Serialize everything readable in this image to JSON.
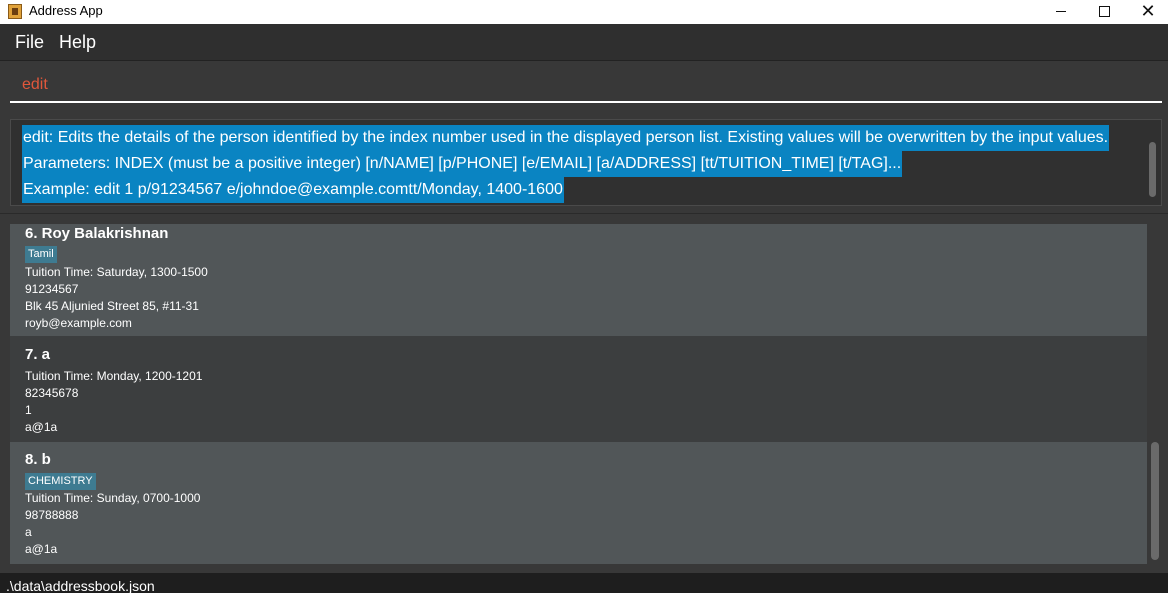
{
  "window": {
    "title": "Address App",
    "icon": "address-book-icon",
    "controls": {
      "minimize": "minimize-icon",
      "maximize": "maximize-icon",
      "close_glyph": "✕"
    }
  },
  "menu": {
    "file": "File",
    "help": "Help"
  },
  "command": {
    "value": "edit"
  },
  "result": {
    "lines": [
      "edit: Edits the details of the person identified by the index number used in the displayed person list. Existing values will be overwritten by the input values.",
      "Parameters: INDEX (must be a positive integer) [n/NAME] [p/PHONE] [e/EMAIL] [a/ADDRESS] [tt/TUITION_TIME] [t/TAG]...",
      "Example: edit 1 p/91234567 e/johndoe@example.comtt/Monday, 1400-1600"
    ],
    "highlight_color": "#0a84c2"
  },
  "persons": [
    {
      "name": "6. Roy Balakrishnan",
      "tag": "Tamil",
      "tuition_time": "Tuition Time: Saturday, 1300-1500",
      "phone": "91234567",
      "address": "Blk 45 Aljunied Street 85, #11-31",
      "email": "royb@example.com"
    },
    {
      "name": "7. a",
      "tag": "",
      "tuition_time": "Tuition Time: Monday, 1200-1201",
      "phone": "82345678",
      "address": "1",
      "email": "a@1a"
    },
    {
      "name": "8. b",
      "tag": "CHEMISTRY",
      "tuition_time": "Tuition Time: Sunday, 0700-1000",
      "phone": "98788888",
      "address": "a",
      "email": "a@1a"
    }
  ],
  "status": {
    "path": ".\\data\\addressbook.json"
  },
  "colors": {
    "background": "#383838",
    "card_light": "#515658",
    "card_dark": "#3c3e3f",
    "tag": "#3e7b91",
    "command_text": "#e0573b"
  }
}
